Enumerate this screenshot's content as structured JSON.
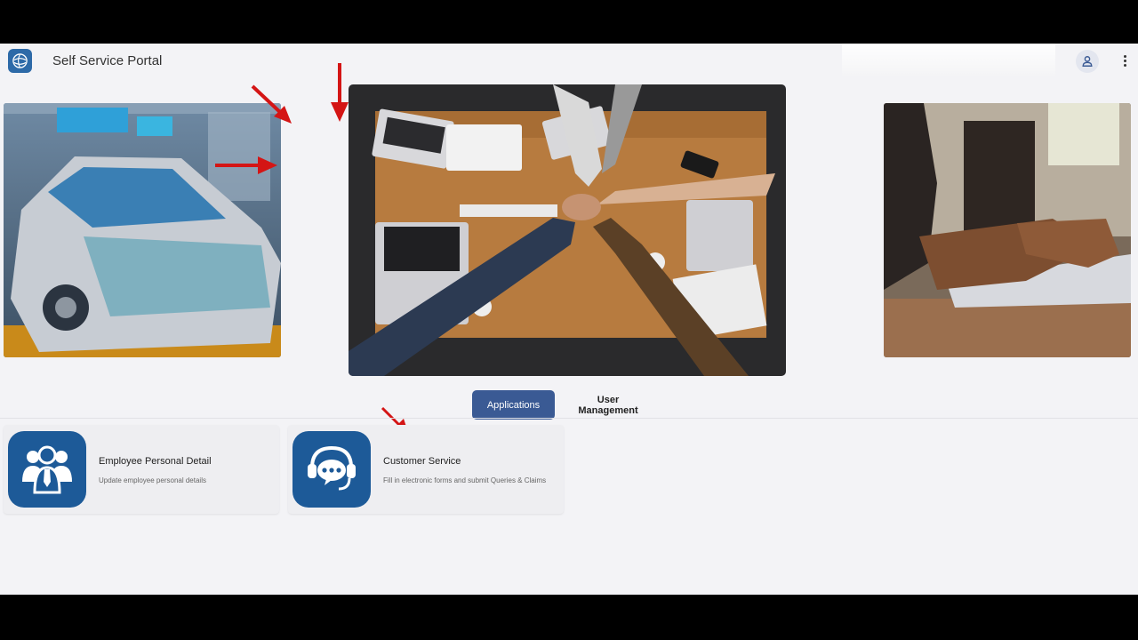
{
  "header": {
    "app_title": "Self Service Portal",
    "logo_icon": "globe-icon",
    "user_icon": "user-icon",
    "menu_icon": "kebab-menu-icon"
  },
  "banners": [
    {
      "name": "car-factory-image"
    },
    {
      "name": "team-hands-image"
    },
    {
      "name": "laptop-typing-image"
    }
  ],
  "tabs": [
    {
      "label": "Applications",
      "active": true
    },
    {
      "label": "User Management",
      "active": false
    }
  ],
  "applications": [
    {
      "title": "Employee Personal Detail",
      "description": "Update employee personal details",
      "icon": "employee-group-icon"
    },
    {
      "title": "Customer Service",
      "description": "Fill in electronic forms and submit Queries & Claims",
      "icon": "support-chat-icon"
    }
  ],
  "colors": {
    "accent": "#3a5a94",
    "icon_bg": "#1d5a98",
    "annotation_arrow": "#d41515"
  }
}
